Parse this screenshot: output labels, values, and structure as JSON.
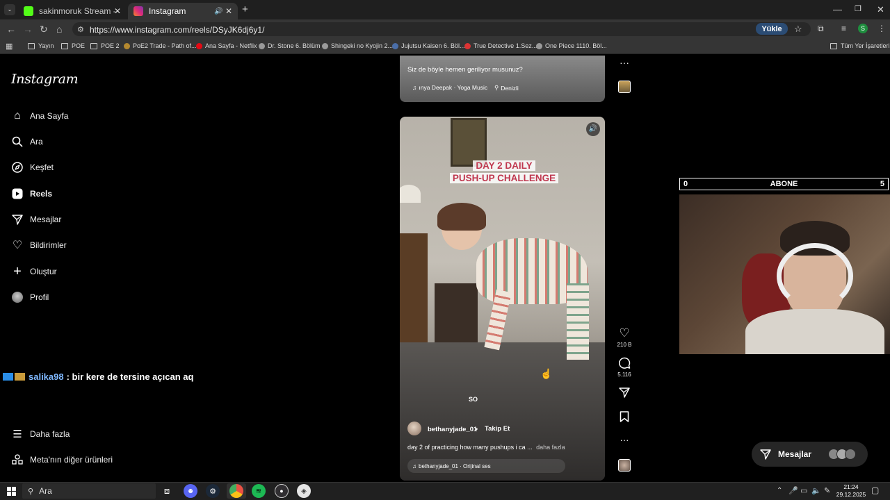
{
  "browser": {
    "tabs": [
      {
        "title": "sakinmoruk Stream - Watch Liv",
        "favicon_color": "#53fc18"
      },
      {
        "title": "Instagram",
        "favicon_color": "#dd2a7b"
      }
    ],
    "url": "https://www.instagram.com/reels/DSyJK6dj6y1/",
    "upload_button": "Yükle",
    "profile_initial": "S",
    "bookmarks": [
      "Yayın",
      "POE",
      "POE 2",
      "PoE2 Trade - Path of...",
      "Ana Sayfa - Netflix",
      "Dr. Stone 6. Bölüm",
      "Shingeki no Kyojin 2...",
      "Jujutsu Kaisen 6. Böl...",
      "True Detective 1.Sez...",
      "One Piece 1110. Böl..."
    ],
    "all_bookmarks": "Tüm Yer İşaretleri"
  },
  "instagram": {
    "logo": "Instagram",
    "nav": [
      {
        "label": "Ana Sayfa",
        "icon": "home-icon"
      },
      {
        "label": "Ara",
        "icon": "search-icon"
      },
      {
        "label": "Keşfet",
        "icon": "explore-icon"
      },
      {
        "label": "Reels",
        "icon": "reels-icon"
      },
      {
        "label": "Mesajlar",
        "icon": "messages-icon"
      },
      {
        "label": "Bildirimler",
        "icon": "heart-icon"
      },
      {
        "label": "Oluştur",
        "icon": "plus-icon"
      },
      {
        "label": "Profil",
        "icon": "avatar"
      }
    ],
    "more": "Daha fazla",
    "meta": "Meta'nın diğer ürünleri",
    "prev_reel": {
      "caption": "Siz de böyle hemen geriliyor musunuz?",
      "music": "ınya Deepak · Yoga Music",
      "location": "Denizli"
    },
    "reel": {
      "overlay_line1": "DAY 2 DAILY",
      "overlay_line2": "PUSH-UP CHALLENGE",
      "subtitle": "SO",
      "username": "bethanyjade_01",
      "separator": "•",
      "follow": "Takip Et",
      "caption": "day 2 of practicing how many pushups i ca ...",
      "more": "daha fazla",
      "audio": "bethanyjade_01 · Orijinal ses",
      "likes": "210 B",
      "comments": "5.116"
    },
    "messages_pill": "Mesajlar"
  },
  "stream": {
    "sub_left": "0",
    "sub_label": "ABONE",
    "sub_right": "5",
    "chat_user": "salika98",
    "chat_text": ": bir kere de tersine açıcan aq"
  },
  "taskbar": {
    "search": "Ara",
    "time": "21:24",
    "date": "29.12.2025"
  }
}
